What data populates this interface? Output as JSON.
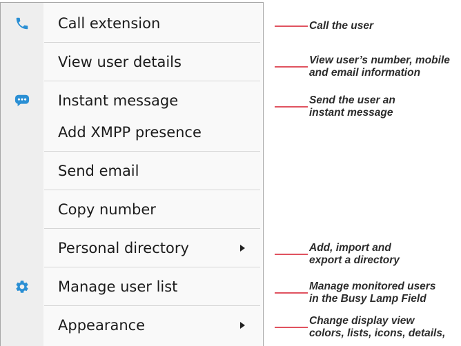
{
  "menu": {
    "items": [
      {
        "label": "Call extension",
        "icon": "phone-icon",
        "submenu": false
      },
      {
        "label": "View user details",
        "icon": null,
        "submenu": false
      },
      {
        "label": "Instant message",
        "icon": "chat-bubble-icon",
        "submenu": false
      },
      {
        "label": "Add XMPP presence",
        "icon": null,
        "submenu": false
      },
      {
        "label": "Send email",
        "icon": null,
        "submenu": false
      },
      {
        "label": "Copy number",
        "icon": null,
        "submenu": false
      },
      {
        "label": "Personal directory",
        "icon": null,
        "submenu": true
      },
      {
        "label": "Manage user list",
        "icon": "gear-icon",
        "submenu": false
      },
      {
        "label": "Appearance",
        "icon": null,
        "submenu": true
      }
    ]
  },
  "annotations": [
    {
      "lines": [
        "Call the user"
      ]
    },
    {
      "lines": [
        "View user’s number, mobile",
        "and email information"
      ]
    },
    {
      "lines": [
        "Send the user an",
        "instant message"
      ]
    },
    {
      "lines": [
        "Add, import and",
        "export a directory"
      ]
    },
    {
      "lines": [
        "Manage monitored users",
        "in the Busy Lamp Field"
      ]
    },
    {
      "lines": [
        "Change display view",
        "colors, lists, icons, details,"
      ]
    }
  ],
  "colors": {
    "icon_accent": "#2a8fd4",
    "annotation_line": "#e0525f",
    "menu_text": "#1b1b1b",
    "annotation_text": "#2b2b2b"
  }
}
